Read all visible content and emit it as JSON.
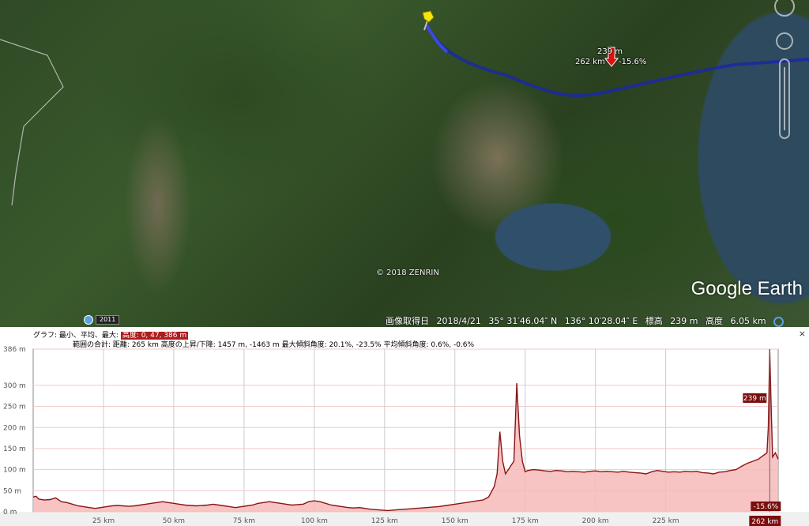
{
  "map": {
    "copyright": "© 2018 ZENRIN",
    "logo": "Google Earth",
    "year_badge": "2011",
    "marker_elev": "239 m",
    "marker_dist": "262 km",
    "marker_grade": "-15.6%",
    "route_color": "#1c2a9c",
    "pin_color": "#f2e60c"
  },
  "status": {
    "image_date_label": "画像取得日",
    "image_date": "2018/4/21",
    "lat": "35° 31′46.04″ N",
    "lon": "136° 10′28.04″ E",
    "elev_label": "標高",
    "elev": "239 m",
    "alt_label": "高度",
    "alt": "6.05 km"
  },
  "profile_header": {
    "graph_label": "グラフ: 最小、平均、最大:",
    "graph_value": "高度: 0, 47, 386 m",
    "totals_label": "範囲の合計:",
    "distance": "距離: 265 km",
    "elev_gain_loss": "高度の上昇/下降: 1457 m, -1463 m",
    "max_slope": "最大傾斜角度: 20.1%, -23.5%",
    "avg_slope": "平均傾斜角度: 0.6%, -0.6%",
    "close_label": "×"
  },
  "chart_data": {
    "type": "area",
    "x_unit": "km",
    "y_unit": "m",
    "xlim": [
      0,
      265
    ],
    "ylim": [
      0,
      386
    ],
    "x_ticks": [
      "25 km",
      "50 km",
      "75 km",
      "100 km",
      "125 km",
      "150 km",
      "175 km",
      "200 km",
      "225 km"
    ],
    "y_ticks": [
      "0 m",
      "50 m",
      "100 m",
      "150 m",
      "200 m",
      "250 m",
      "300 m",
      "386 m"
    ],
    "x": [
      0,
      1,
      2,
      4,
      6,
      8,
      10,
      12,
      14,
      16,
      18,
      20,
      22,
      24,
      26,
      28,
      30,
      32,
      34,
      36,
      38,
      40,
      42,
      44,
      46,
      48,
      50,
      52,
      54,
      56,
      58,
      60,
      62,
      64,
      66,
      68,
      70,
      72,
      74,
      76,
      78,
      80,
      82,
      84,
      86,
      88,
      90,
      92,
      94,
      96,
      98,
      100,
      102,
      104,
      106,
      108,
      110,
      112,
      114,
      116,
      118,
      120,
      122,
      124,
      126,
      128,
      130,
      132,
      134,
      136,
      138,
      140,
      142,
      144,
      146,
      148,
      150,
      152,
      154,
      156,
      158,
      160,
      162,
      164,
      165,
      166,
      167,
      168,
      169,
      170,
      171,
      172,
      173,
      174,
      175,
      176,
      178,
      180,
      182,
      184,
      186,
      188,
      190,
      192,
      194,
      196,
      198,
      200,
      202,
      204,
      206,
      208,
      210,
      212,
      214,
      216,
      218,
      220,
      222,
      224,
      226,
      228,
      230,
      232,
      234,
      236,
      238,
      240,
      242,
      244,
      246,
      248,
      250,
      252,
      254,
      256,
      258,
      259,
      260,
      261,
      261.5,
      262,
      262.5,
      263,
      264,
      265
    ],
    "y": [
      35,
      37,
      30,
      28,
      29,
      33,
      24,
      22,
      18,
      14,
      12,
      10,
      8,
      10,
      12,
      14,
      15,
      14,
      13,
      14,
      16,
      18,
      20,
      22,
      24,
      22,
      20,
      18,
      16,
      15,
      14,
      15,
      16,
      18,
      16,
      14,
      12,
      10,
      12,
      14,
      16,
      20,
      22,
      24,
      22,
      20,
      18,
      16,
      17,
      18,
      24,
      26,
      24,
      20,
      16,
      14,
      12,
      10,
      9,
      10,
      8,
      6,
      5,
      4,
      3,
      4,
      5,
      6,
      7,
      8,
      9,
      10,
      11,
      12,
      14,
      16,
      18,
      20,
      22,
      24,
      26,
      28,
      35,
      60,
      90,
      190,
      120,
      90,
      100,
      110,
      120,
      305,
      180,
      120,
      95,
      98,
      100,
      99,
      97,
      96,
      98,
      97,
      95,
      96,
      95,
      94,
      96,
      97,
      95,
      96,
      95,
      94,
      96,
      94,
      93,
      92,
      90,
      95,
      98,
      96,
      94,
      95,
      94,
      96,
      95,
      96,
      93,
      92,
      90,
      94,
      95,
      98,
      100,
      108,
      115,
      120,
      125,
      130,
      135,
      140,
      200,
      386,
      250,
      130,
      140,
      125
    ],
    "current_km": 262,
    "current_elev_label": "239 m",
    "current_x_label": "262 km",
    "current_grade_label": "-15.6%",
    "line_color": "#8b1414",
    "fill_color": "#f7b8b8",
    "grid": true
  }
}
